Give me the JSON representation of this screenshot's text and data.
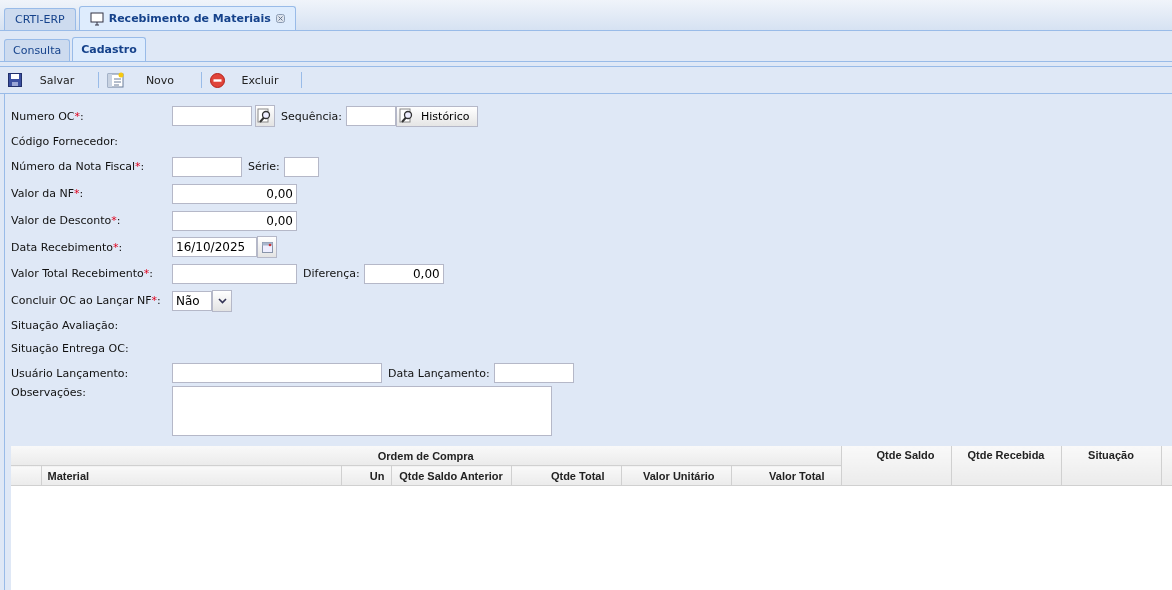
{
  "window_tabs": [
    {
      "label": "CRTI-ERP",
      "selected": false,
      "closable": false
    },
    {
      "label": "Recebimento de Materiais",
      "selected": true,
      "closable": true
    }
  ],
  "sub_tabs": [
    {
      "label": "Consulta",
      "selected": false
    },
    {
      "label": "Cadastro",
      "selected": true
    }
  ],
  "toolbar": [
    {
      "kind": "save",
      "label": "Salvar"
    },
    {
      "kind": "new",
      "label": "Novo"
    },
    {
      "kind": "delete",
      "label": "Excluir"
    }
  ],
  "form_rows": [
    {
      "items": [
        {
          "kind": "label",
          "text": "Numero OC",
          "required": "*",
          "suffix": ":"
        },
        {
          "kind": "lookup"
        },
        {
          "kind": "label",
          "text": "Sequência",
          "suffix": ":"
        },
        {
          "kind": "text"
        },
        {
          "kind": "button",
          "text": "Histórico"
        }
      ]
    },
    {
      "items": [
        {
          "kind": "label",
          "text": "Código Fornecedor",
          "suffix": ":"
        }
      ]
    },
    {
      "items": [
        {
          "kind": "label",
          "text": "Número da Nota Fiscal",
          "required": "*",
          "suffix": ":"
        },
        {
          "kind": "text"
        },
        {
          "kind": "label",
          "text": "Série",
          "suffix": ":"
        },
        {
          "kind": "text"
        }
      ]
    },
    {
      "items": [
        {
          "kind": "label",
          "text": "Valor da NF",
          "required": "*",
          "suffix": ":"
        },
        {
          "kind": "number",
          "value": "0,00"
        }
      ]
    },
    {
      "items": [
        {
          "kind": "label",
          "text": "Valor de Desconto",
          "required": "*",
          "suffix": ":"
        },
        {
          "kind": "number",
          "value": "0,00"
        }
      ]
    },
    {
      "items": [
        {
          "kind": "label",
          "text": "Data Recebimento",
          "required": "*",
          "suffix": ":"
        },
        {
          "kind": "date",
          "value": "16/10/2025"
        }
      ]
    },
    {
      "items": [
        {
          "kind": "label",
          "text": "Valor Total Recebimento",
          "required": "*",
          "suffix": ":"
        },
        {
          "kind": "number"
        },
        {
          "kind": "label",
          "text": "Diferença",
          "suffix": ":"
        },
        {
          "kind": "number",
          "value": "0,00"
        }
      ]
    },
    {
      "items": [
        {
          "kind": "label",
          "text": "Concluir OC ao Lançar NF",
          "required": "*",
          "suffix": ":"
        },
        {
          "kind": "select",
          "value": "Não"
        }
      ]
    },
    {
      "items": [
        {
          "kind": "label",
          "text": "Situação Avaliação",
          "suffix": ":"
        }
      ]
    },
    {
      "items": [
        {
          "kind": "label",
          "text": "Situação Entrega OC",
          "suffix": ":"
        }
      ]
    },
    {
      "items": [
        {
          "kind": "label",
          "text": "Usuário Lançamento",
          "suffix": ":"
        },
        {
          "kind": "text"
        },
        {
          "kind": "label",
          "text": "Data Lançamento",
          "suffix": ":"
        },
        {
          "kind": "text"
        }
      ]
    },
    {
      "items": [
        {
          "kind": "label",
          "text": "Observações",
          "suffix": ":"
        },
        {
          "kind": "memo"
        }
      ]
    }
  ],
  "grid": {
    "group_header": "Ordem de Compra",
    "group_columns": [
      "Material",
      "Un",
      "Qtde Saldo Anterior",
      "Qtde Total",
      "Valor Unitário",
      "Valor Total"
    ],
    "columns": [
      "Qtde Saldo",
      "Qtde Recebida",
      "Situação"
    ]
  }
}
